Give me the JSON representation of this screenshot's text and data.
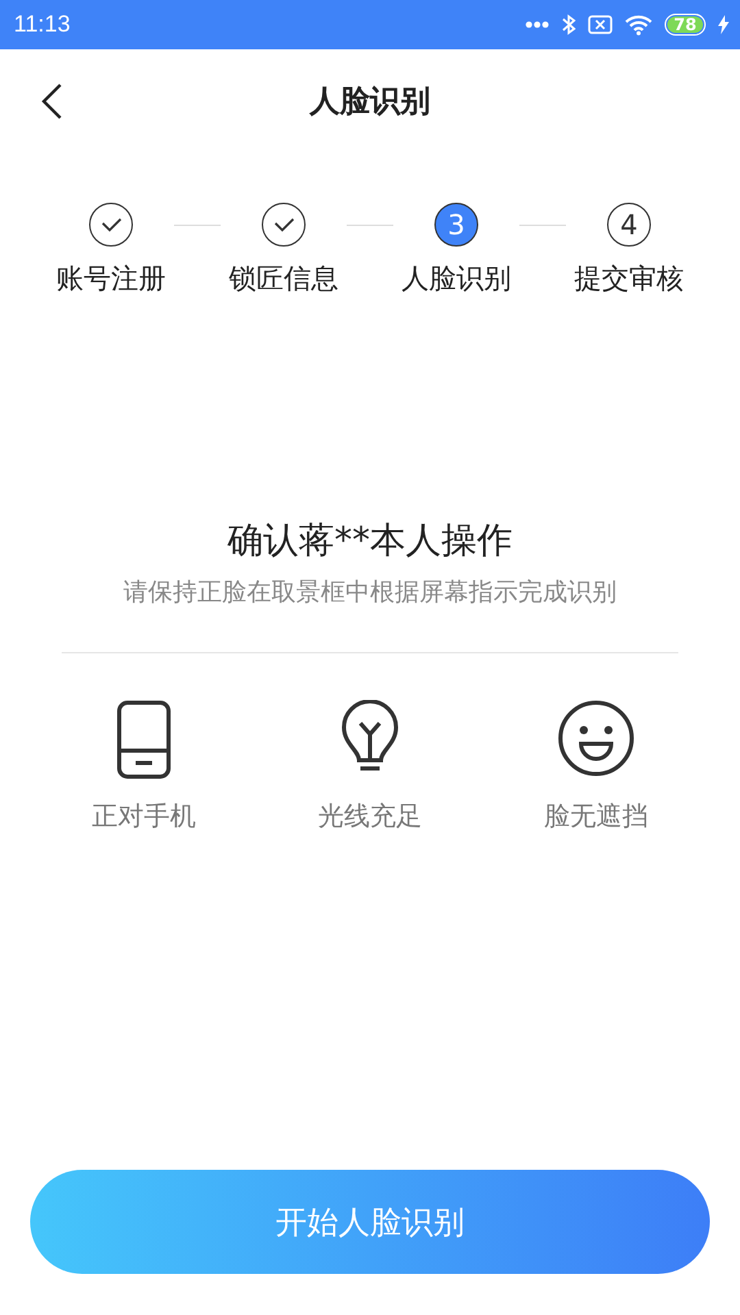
{
  "status_bar": {
    "time": "11:13",
    "battery": "78"
  },
  "header": {
    "title": "人脸识别"
  },
  "steps": [
    {
      "kind": "done",
      "label": "账号注册"
    },
    {
      "kind": "done",
      "label": "锁匠信息"
    },
    {
      "kind": "current",
      "number": "3",
      "label": "人脸识别"
    },
    {
      "kind": "todo",
      "number": "4",
      "label": "提交审核"
    }
  ],
  "title": "确认蒋**本人操作",
  "subtitle": "请保持正脸在取景框中根据屏幕指示完成识别",
  "tips": [
    {
      "kind": "phone",
      "label": "正对手机"
    },
    {
      "kind": "bulb",
      "label": "光线充足"
    },
    {
      "kind": "smile",
      "label": "脸无遮挡"
    }
  ],
  "button": "开始人脸识别"
}
